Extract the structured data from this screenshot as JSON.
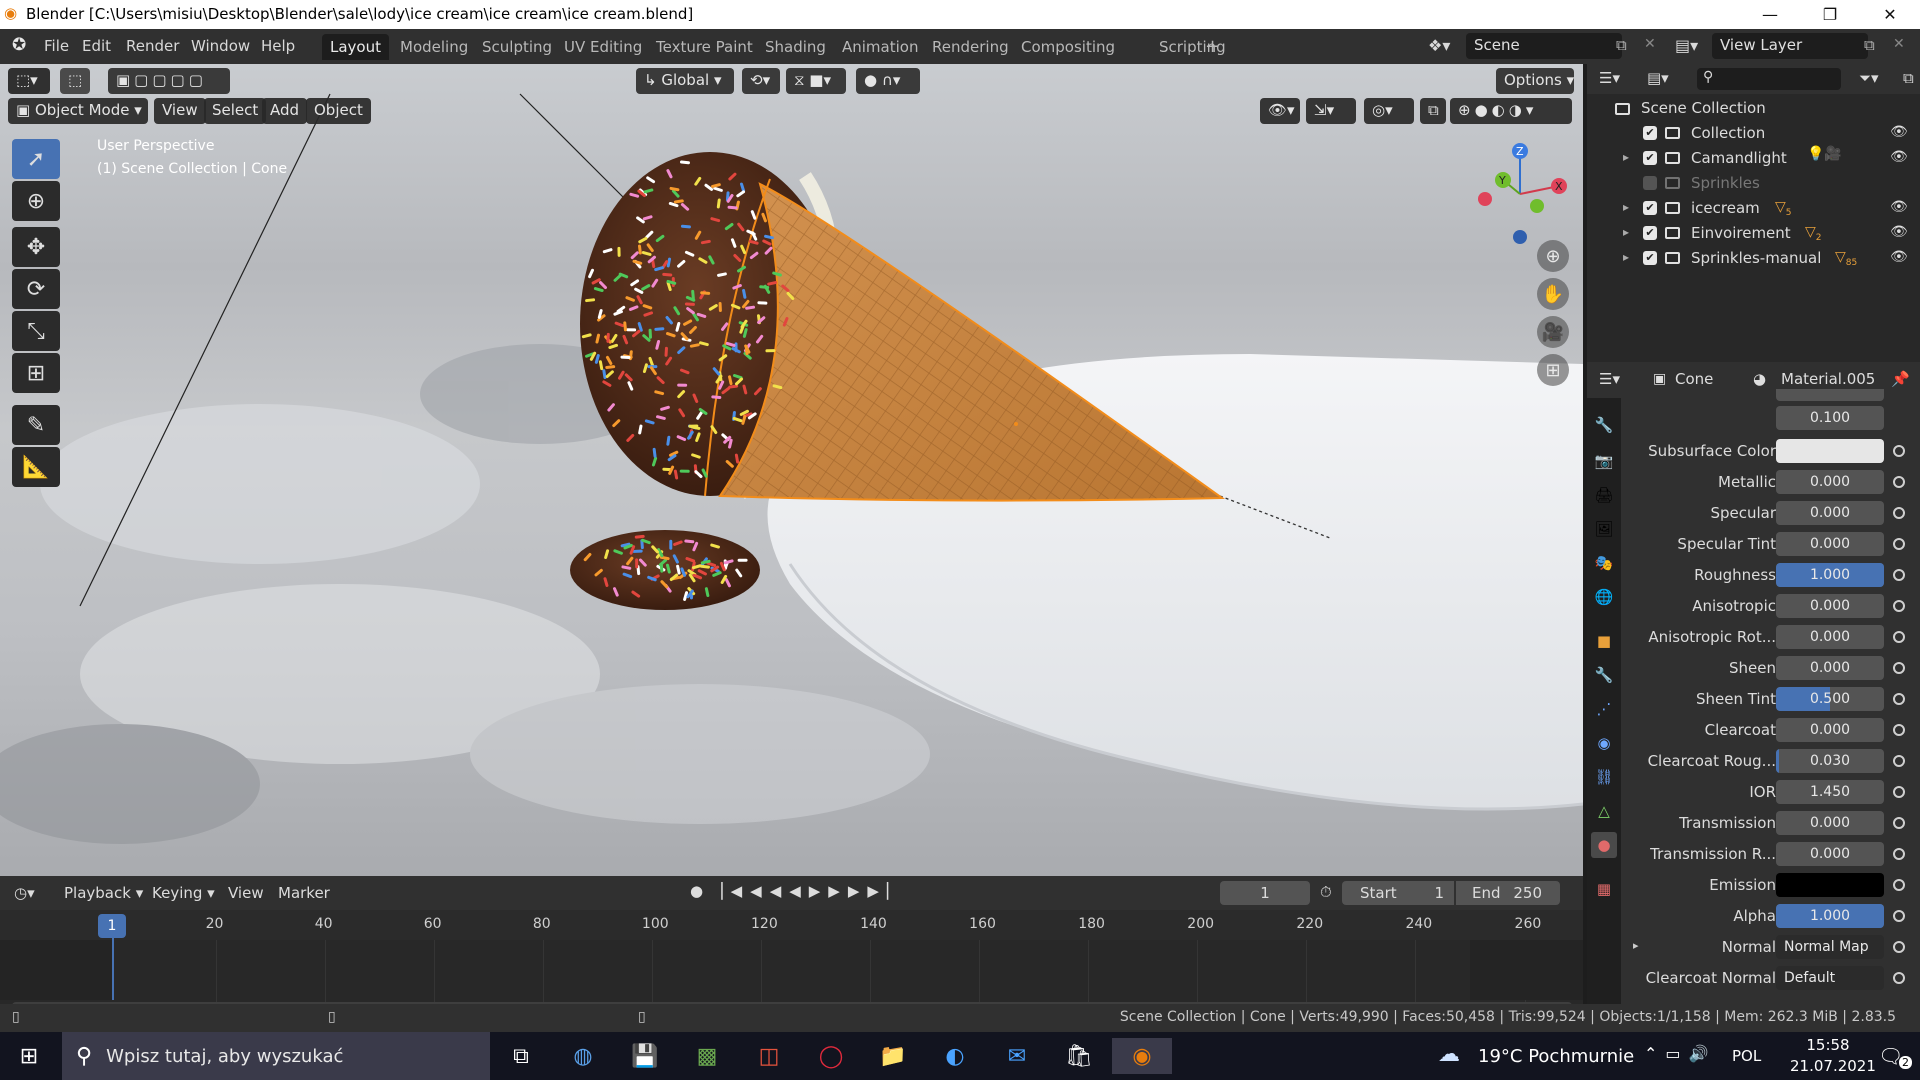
{
  "window": {
    "title": "Blender [C:\\Users\\misiu\\Desktop\\Blender\\sale\\lody\\ice cream\\ice cream\\ice cream.blend]",
    "minimize": "—",
    "maximize": "❐",
    "close": "✕"
  },
  "menu": [
    "File",
    "Edit",
    "Render",
    "Window",
    "Help"
  ],
  "workspaces": [
    "Layout",
    "Modeling",
    "Sculpting",
    "UV Editing",
    "Texture Paint",
    "Shading",
    "Animation",
    "Rendering",
    "Compositing",
    "Scripting"
  ],
  "workspace_add": "+",
  "scene": {
    "label": "Scene",
    "view_layer": "View Layer"
  },
  "header": {
    "transform_orientation": "Global",
    "options": "Options",
    "mode": "Object Mode",
    "view": "View",
    "select": "Select",
    "add": "Add",
    "object": "Object"
  },
  "viewport": {
    "perspective": "User Perspective",
    "collection_info": "(1) Scene Collection | Cone",
    "gizmo": {
      "x": "X",
      "y": "Y",
      "z": "Z"
    }
  },
  "outliner": {
    "root": "Scene Collection",
    "items": [
      {
        "name": "Collection",
        "checked": true,
        "visible": true,
        "expand": "",
        "badge": ""
      },
      {
        "name": "Camandlight",
        "checked": true,
        "visible": true,
        "expand": "▸",
        "badge": ""
      },
      {
        "name": "Sprinkles",
        "checked": false,
        "visible": false,
        "expand": "",
        "badge": ""
      },
      {
        "name": "icecream",
        "checked": true,
        "visible": true,
        "expand": "▸",
        "badge": "5"
      },
      {
        "name": "Einvoirement",
        "checked": true,
        "visible": true,
        "expand": "▸",
        "badge": "2"
      },
      {
        "name": "Sprinkles-manual",
        "checked": true,
        "visible": true,
        "expand": "▸",
        "badge": "85"
      }
    ]
  },
  "properties": {
    "object": "Cone",
    "material": "Material.005",
    "partial_top": "0.100",
    "rows": [
      {
        "label": "Subsurface Color",
        "value": "",
        "type": "color",
        "color": "#e6e6e6"
      },
      {
        "label": "Metallic",
        "value": "0.000",
        "fill": 0
      },
      {
        "label": "Specular",
        "value": "0.000",
        "fill": 0
      },
      {
        "label": "Specular Tint",
        "value": "0.000",
        "fill": 0
      },
      {
        "label": "Roughness",
        "value": "1.000",
        "fill": 1
      },
      {
        "label": "Anisotropic",
        "value": "0.000",
        "fill": 0
      },
      {
        "label": "Anisotropic Rot...",
        "value": "0.000",
        "fill": 0
      },
      {
        "label": "Sheen",
        "value": "0.000",
        "fill": 0
      },
      {
        "label": "Sheen Tint",
        "value": "0.500",
        "fill": 0.5
      },
      {
        "label": "Clearcoat",
        "value": "0.000",
        "fill": 0
      },
      {
        "label": "Clearcoat Roug...",
        "value": "0.030",
        "fill": 0.03
      },
      {
        "label": "IOR",
        "value": "1.450",
        "fill": 0
      },
      {
        "label": "Transmission",
        "value": "0.000",
        "fill": 0
      },
      {
        "label": "Transmission R...",
        "value": "0.000",
        "fill": 0
      },
      {
        "label": "Emission",
        "value": "",
        "type": "color",
        "color": "#000000"
      },
      {
        "label": "Alpha",
        "value": "1.000",
        "fill": 1
      },
      {
        "label": "Normal",
        "value": "Normal Map",
        "type": "text",
        "expand": "▸"
      },
      {
        "label": "Clearcoat Normal",
        "value": "Default",
        "type": "text"
      }
    ]
  },
  "timeline": {
    "playback": "Playback",
    "keying": "Keying",
    "view": "View",
    "marker": "Marker",
    "current_frame": "1",
    "start_label": "Start",
    "start": "1",
    "end_label": "End",
    "end": "250",
    "playhead": "1",
    "ticks": [
      "20",
      "40",
      "60",
      "80",
      "100",
      "120",
      "140",
      "160",
      "180",
      "200",
      "220",
      "240",
      "260"
    ]
  },
  "status": "Scene Collection | Cone | Verts:49,990 | Faces:50,458 | Tris:99,524 | Objects:1/1,158 | Mem: 262.3 MiB | 2.83.5",
  "taskbar": {
    "search_placeholder": "Wpisz tutaj, aby wyszukać",
    "weather": "19°C Pochmurnie",
    "lang": "POL",
    "time": "15:58",
    "date": "21.07.2021",
    "notif_count": "2"
  },
  "colors": {
    "accent_blue": "#4772b3",
    "cone": "#c98a45",
    "chocolate": "#4a2a1a",
    "blender_orange": "#e87d0d"
  }
}
